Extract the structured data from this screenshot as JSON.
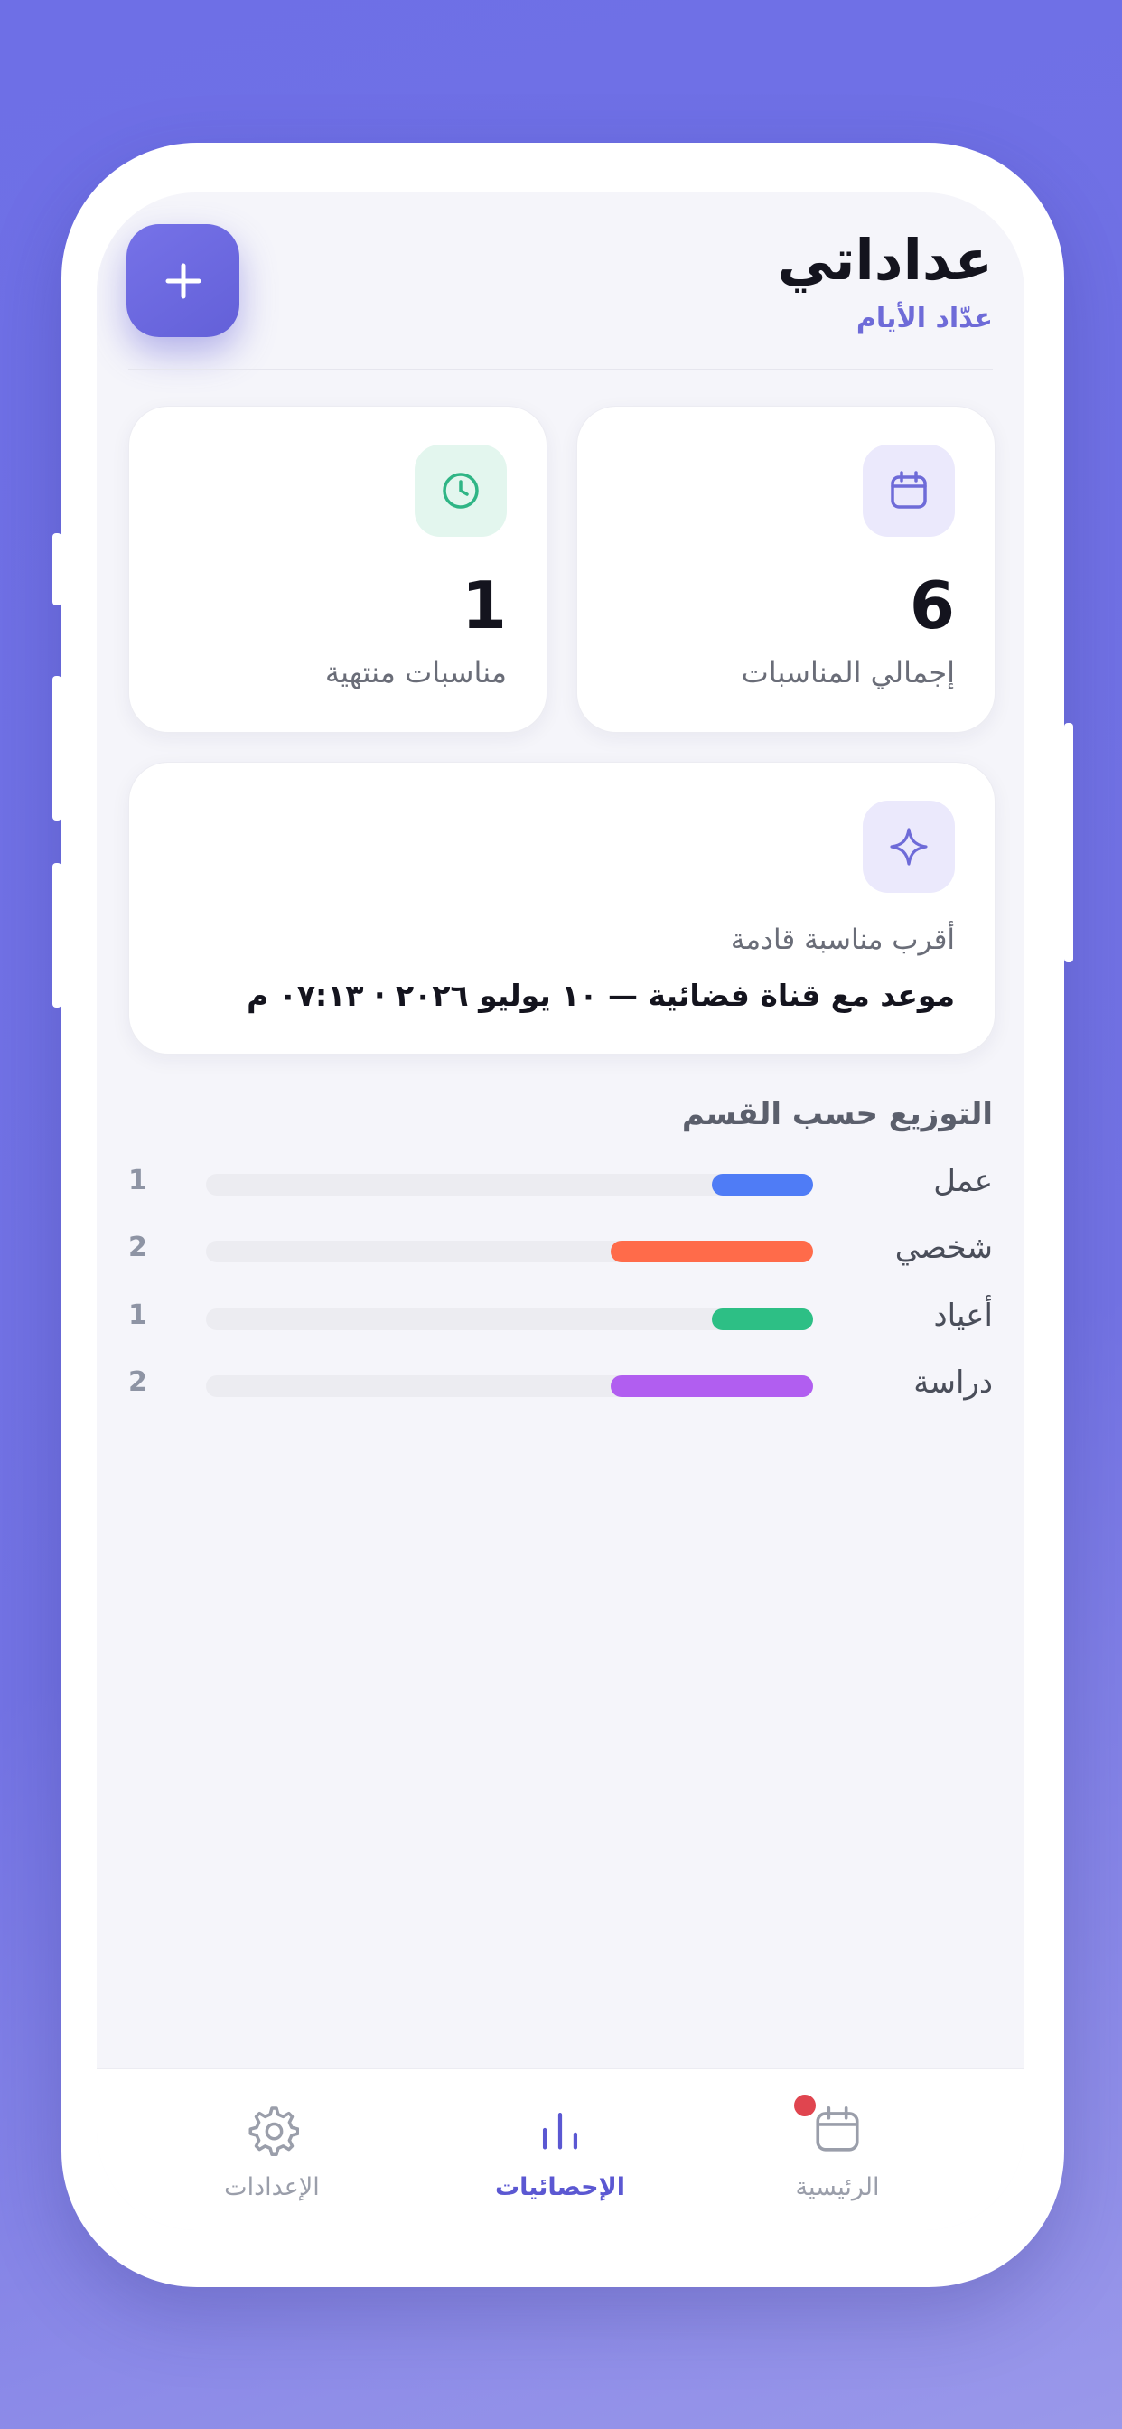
{
  "header": {
    "title": "عداداتي",
    "subtitle": "عدّاد الأيام",
    "add_icon": "plus-icon"
  },
  "stats": {
    "total": {
      "value": "6",
      "label": "إجمالي المناسبات",
      "icon": "calendar-icon",
      "accent": "#6e6bd8"
    },
    "ended": {
      "value": "1",
      "label": "مناسبات منتهية",
      "icon": "clock-icon",
      "accent": "#2fb585"
    }
  },
  "next_event": {
    "label": "أقرب مناسبة قادمة",
    "value": "موعد مع قناة فضائية — ١٠ يوليو ٢٠٢٦ · ٠٧:١٣ م",
    "icon": "sparkle-icon"
  },
  "distribution": {
    "title": "التوزيع حسب القسم",
    "max": 6,
    "items": [
      {
        "label": "عمل",
        "count": "1",
        "value": 1,
        "color": "#4f7cf6"
      },
      {
        "label": "شخصي",
        "count": "2",
        "value": 2,
        "color": "#ff6b4a"
      },
      {
        "label": "أعياد",
        "count": "1",
        "value": 1,
        "color": "#2dbf85"
      },
      {
        "label": "دراسة",
        "count": "2",
        "value": 2,
        "color": "#b15ef0"
      }
    ]
  },
  "tabbar": {
    "tabs": [
      {
        "label": "الرئيسية",
        "icon": "calendar-icon",
        "active": false,
        "badge": true
      },
      {
        "label": "الإحصائيات",
        "icon": "bar-chart-icon",
        "active": true,
        "badge": false
      },
      {
        "label": "الإعدادات",
        "icon": "gear-icon",
        "active": false,
        "badge": false
      }
    ]
  },
  "colors": {
    "accent": "#6e6bd8",
    "background": "#6e6fe6"
  }
}
